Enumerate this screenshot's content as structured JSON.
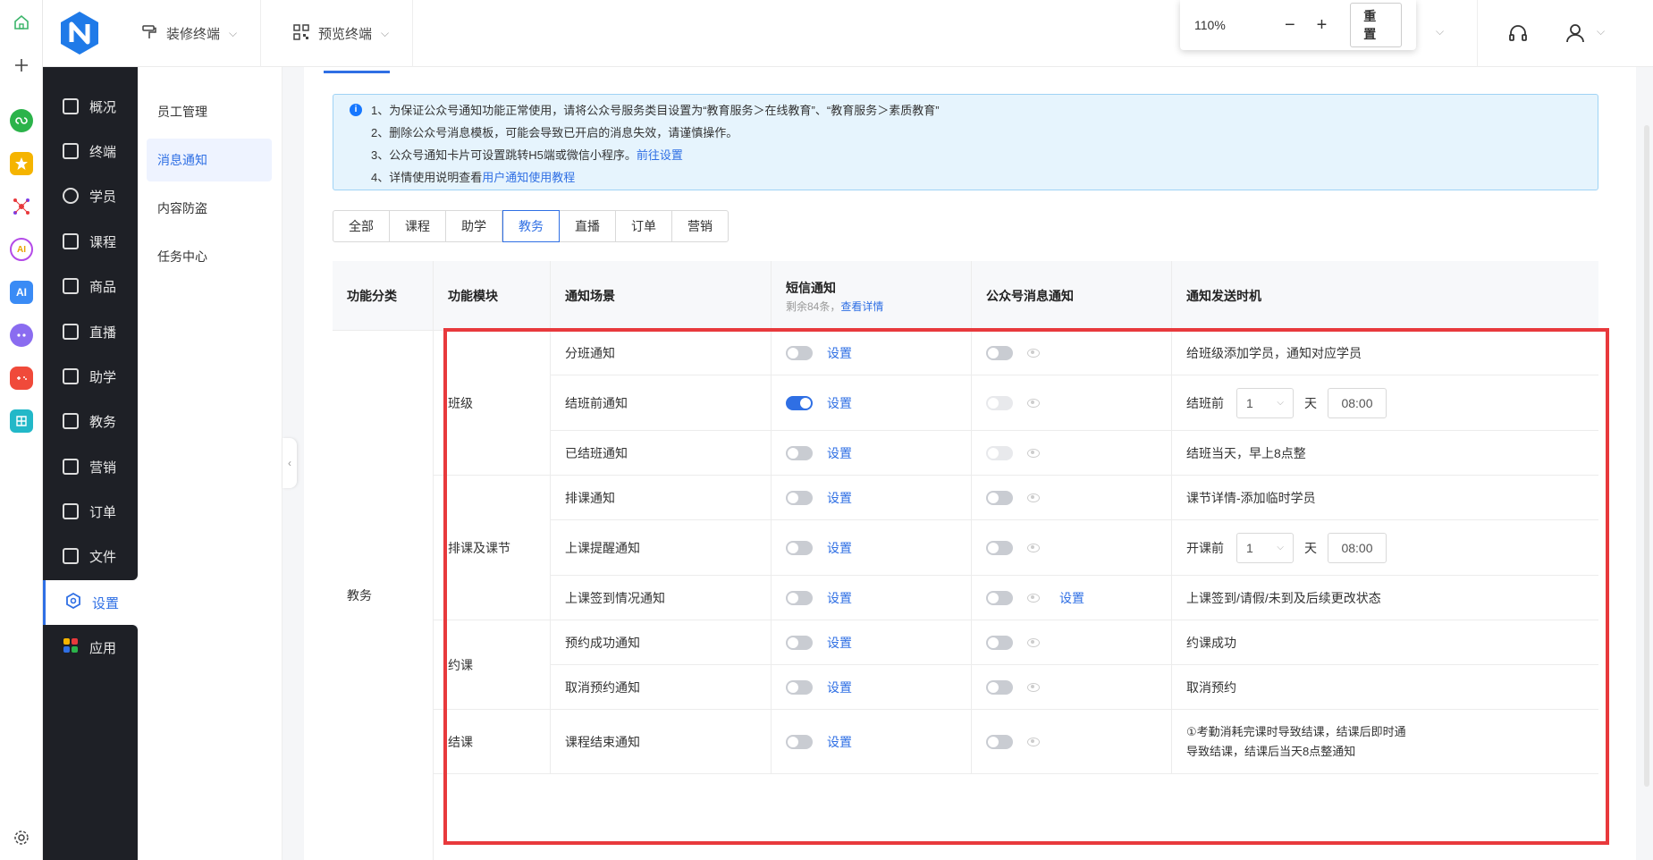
{
  "rail": {
    "icons": [
      "home-icon",
      "plus-icon",
      "miniapp-icon",
      "star-icon",
      "network-icon",
      "ai-circle-icon",
      "ai-square-icon",
      "bot-icon",
      "game-icon",
      "puzzle-icon",
      "gear-icon"
    ],
    "ai_label": "AI"
  },
  "topbar": {
    "decor_label": "装修终端",
    "preview_label": "预览终端",
    "zoom": "110%",
    "zoom_out": "−",
    "zoom_in": "+",
    "reset_label": "重置"
  },
  "nav": {
    "items": [
      "概况",
      "终端",
      "学员",
      "课程",
      "商品",
      "直播",
      "助学",
      "教务",
      "营销",
      "订单",
      "文件"
    ],
    "active": "设置",
    "apps": "应用"
  },
  "subnav": {
    "items": [
      "员工管理",
      "消息通知",
      "内容防盗",
      "任务中心"
    ]
  },
  "notice": {
    "line1": "1、为保证公众号通知功能正常使用，请将公众号服务类目设置为“教育服务＞在线教育”、“教育服务＞素质教育”",
    "line2": "2、删除公众号消息模板，可能会导致已开启的消息失效，请谨慎操作。",
    "line3": "3、公众号通知卡片可设置跳转H5端或微信小程序。",
    "line3_link": "前往设置",
    "line4": "4、详情使用说明查看",
    "line4_link": "用户通知使用教程"
  },
  "filters": [
    "全部",
    "课程",
    "助学",
    "教务",
    "直播",
    "订单",
    "营销"
  ],
  "table": {
    "headers": {
      "category": "功能分类",
      "module": "功能模块",
      "scene": "通知场景",
      "sms": "短信通知",
      "sms_sub": "剩余84条，",
      "sms_link": "查看详情",
      "wechat": "公众号消息通知",
      "timing": "通知发送时机"
    },
    "category": "教务",
    "modules": [
      "班级",
      "排课及课节",
      "约课",
      "结课"
    ],
    "set_label": "设置",
    "rows": [
      {
        "scene": "分班通知",
        "timing": "给班级添加学员，通知对应学员"
      },
      {
        "scene": "结班前通知",
        "timing_prefix": "结班前",
        "days": "1",
        "unit": "天",
        "time": "08:00"
      },
      {
        "scene": "已结班通知",
        "timing": "结班当天，早上8点整"
      },
      {
        "scene": "排课通知",
        "timing": "课节详情-添加临时学员"
      },
      {
        "scene": "上课提醒通知",
        "timing_prefix": "开课前",
        "days": "1",
        "unit": "天",
        "time": "08:00"
      },
      {
        "scene": "上课签到情况通知",
        "timing": "上课签到/请假/未到及后续更改状态"
      },
      {
        "scene": "预约成功通知",
        "timing": "约课成功"
      },
      {
        "scene": "取消预约通知",
        "timing": "取消预约"
      },
      {
        "scene": "课程结束通知",
        "timing_line1": "①考勤消耗完课时导致结课，结课后即时通",
        "timing_line2": "导致结课，结课后当天8点整通知"
      }
    ]
  },
  "colors": {
    "accent": "#2f6fe4",
    "sidebar": "#1e2026",
    "highlight": "#e8393c",
    "notice_bg": "#e6f4fd"
  }
}
